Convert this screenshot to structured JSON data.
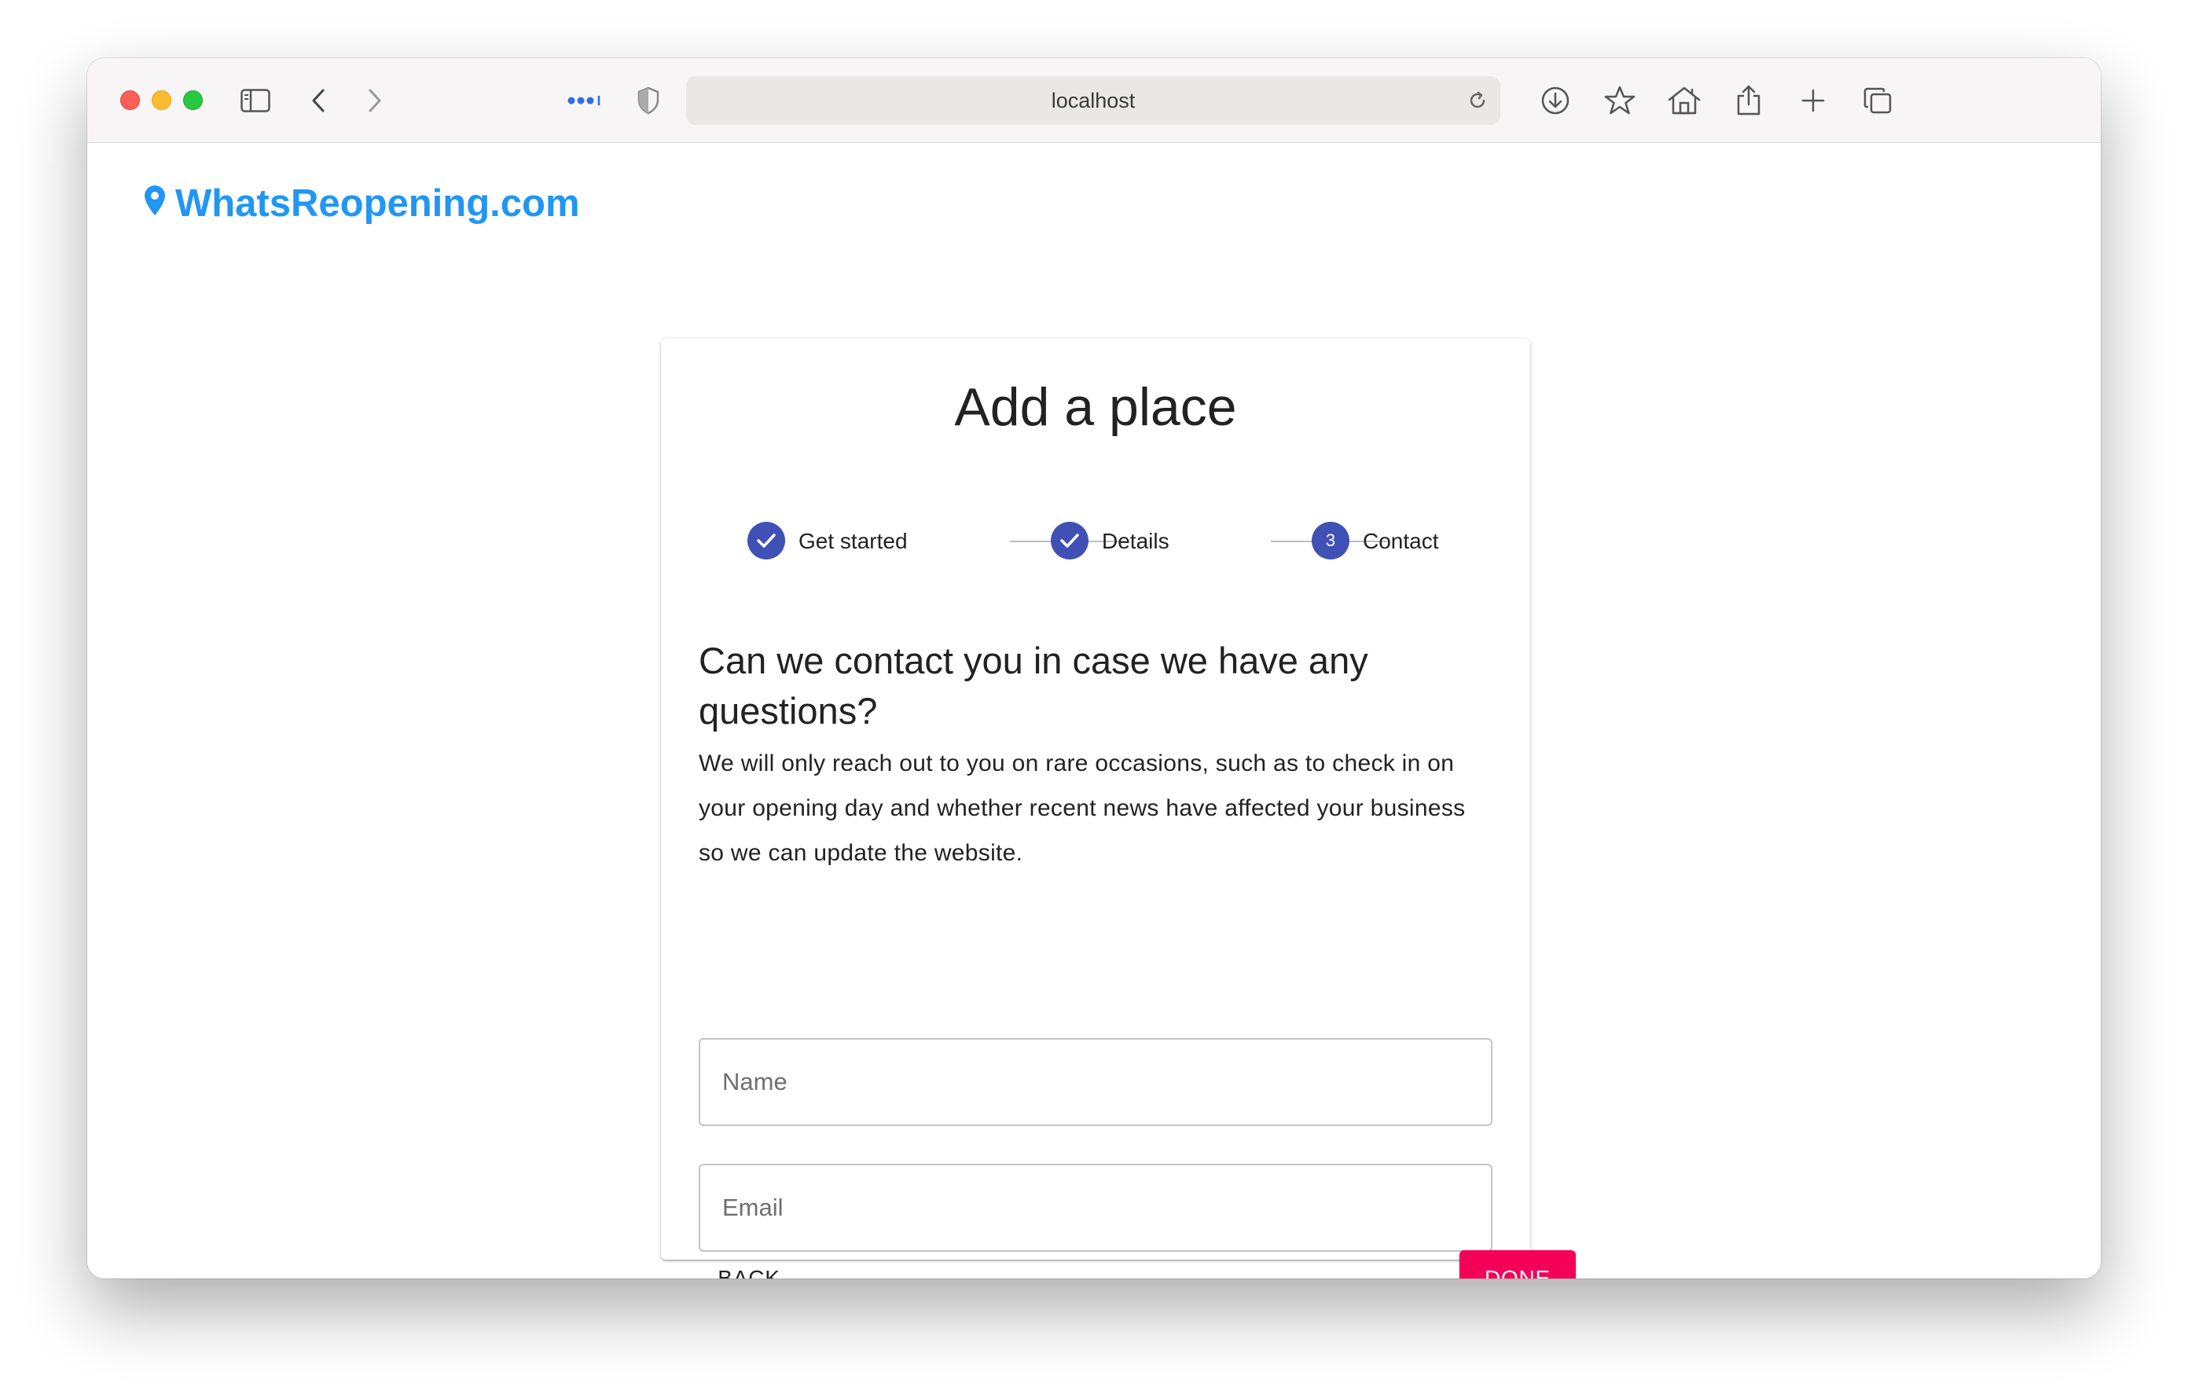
{
  "browser": {
    "address": "localhost",
    "toolbar_icons": [
      "sidebar-icon",
      "back-icon",
      "forward-icon",
      "more-icon",
      "shield-icon",
      "reload-icon",
      "download-icon",
      "star-icon",
      "home-icon",
      "share-icon",
      "plus-icon",
      "tabs-icon"
    ]
  },
  "brand": {
    "name": "WhatsReopening.com",
    "color": "#2196f3",
    "icon": "map-pin-icon"
  },
  "card": {
    "title": "Add a place",
    "steps": [
      {
        "label": "Get started",
        "state": "completed"
      },
      {
        "label": "Details",
        "state": "completed"
      },
      {
        "label": "Contact",
        "state": "active",
        "number": "3"
      }
    ],
    "question": "Can we contact you in case we have any questions?",
    "description": "We will only reach out to you on rare occasions, such as to check in on your opening day and whether recent news have affected your business so we can update the website.",
    "fields": {
      "name": {
        "placeholder": "Name",
        "value": ""
      },
      "email": {
        "placeholder": "Email",
        "value": ""
      }
    },
    "buttons": {
      "back": "BACK",
      "done": "DONE"
    }
  },
  "colors": {
    "primary": "#3f51b5",
    "accent": "#f50057"
  }
}
